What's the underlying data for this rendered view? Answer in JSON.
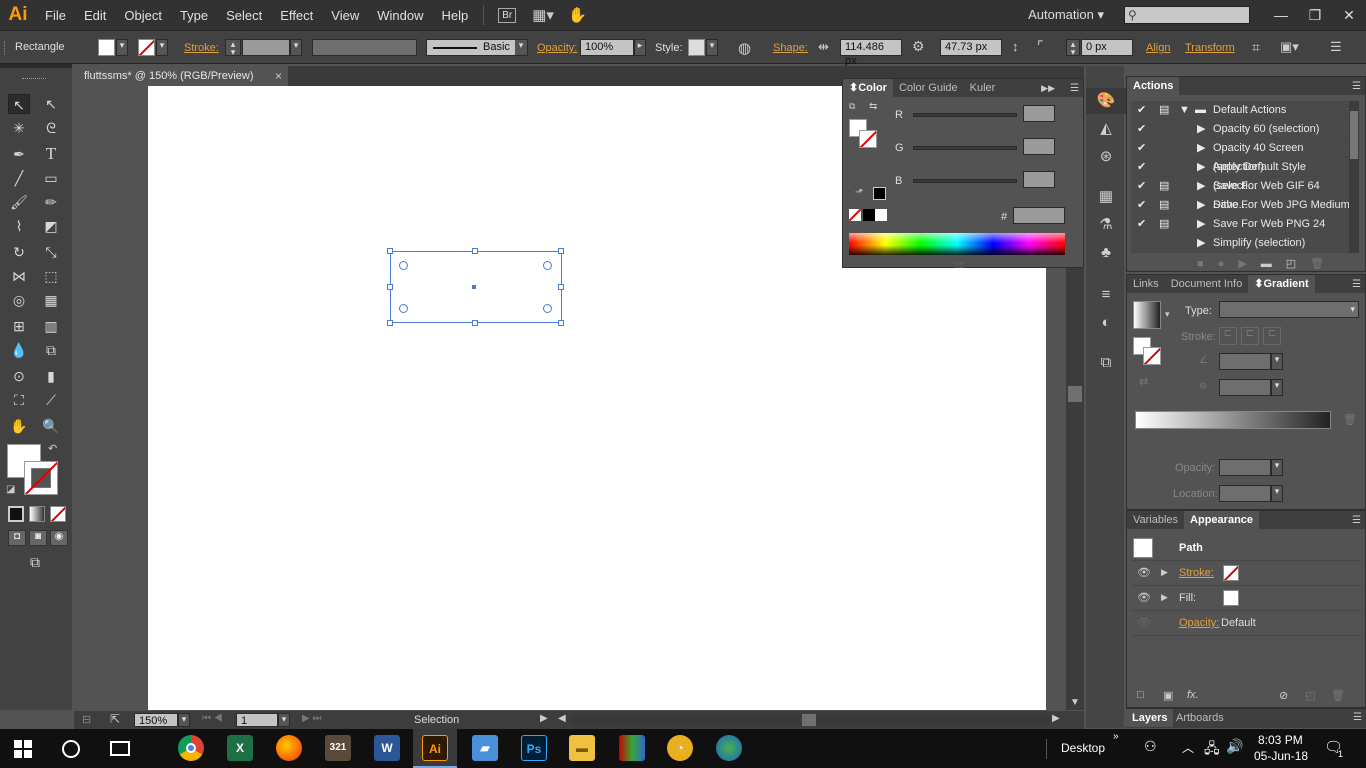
{
  "app": {
    "logo": "Ai",
    "workspace": "Automation"
  },
  "menu": [
    "File",
    "Edit",
    "Object",
    "Type",
    "Select",
    "Effect",
    "View",
    "Window",
    "Help"
  ],
  "menu_badge": "Br",
  "control": {
    "tool_name": "Rectangle",
    "stroke_label": "Stroke:",
    "brush_style": "Basic",
    "opacity_label": "Opacity:",
    "opacity_value": "100%",
    "style_label": "Style:",
    "shape_label": "Shape:",
    "width_value": "114.486 px",
    "height_value": "47.73 px",
    "corner_value": "0 px",
    "align_label": "Align",
    "transform_label": "Transform"
  },
  "document": {
    "tab_title": "fluttssms* @ 150% (RGB/Preview)",
    "close": "×"
  },
  "status": {
    "zoom": "150%",
    "page": "1",
    "tool": "Selection"
  },
  "color_panel": {
    "tabs": [
      "Color",
      "Color Guide",
      "Kuler"
    ],
    "channels": [
      "R",
      "G",
      "B"
    ],
    "hex_label": "#"
  },
  "actions_panel": {
    "title": "Actions",
    "set_name": "Default Actions",
    "items": [
      "Opacity 60 (selection)",
      "Opacity 40 Screen (selection)",
      "Apply Default Style (selecti...",
      "Save For Web GIF 64 Dithe...",
      "Save For Web JPG Medium",
      "Save For Web PNG 24",
      "Simplify (selection)"
    ]
  },
  "gradient_panel": {
    "tabs": [
      "Links",
      "Document Info",
      "Gradient"
    ],
    "type_label": "Type:",
    "stroke_label": "Stroke:",
    "opacity_label": "Opacity:",
    "location_label": "Location:"
  },
  "appearance_panel": {
    "tabs": [
      "Variables",
      "Appearance"
    ],
    "object": "Path",
    "stroke_label": "Stroke:",
    "fill_label": "Fill:",
    "opacity_label": "Opacity:",
    "opacity_value": "Default"
  },
  "layers_panel": {
    "tabs": [
      "Layers",
      "Artboards"
    ]
  },
  "taskbar": {
    "desktop": "Desktop",
    "time": "8:03 PM",
    "date": "05-Jun-18",
    "notification_count": "1",
    "apps": [
      "chrome",
      "excel",
      "firefox",
      "video-321",
      "word",
      "illustrator",
      "file-manager",
      "photoshop",
      "explorer",
      "winrar",
      "tool",
      "browser"
    ]
  },
  "colors": {
    "accent": "#ff9a00",
    "label_orange": "#e0a040",
    "selection_blue": "#4a7bd9"
  }
}
